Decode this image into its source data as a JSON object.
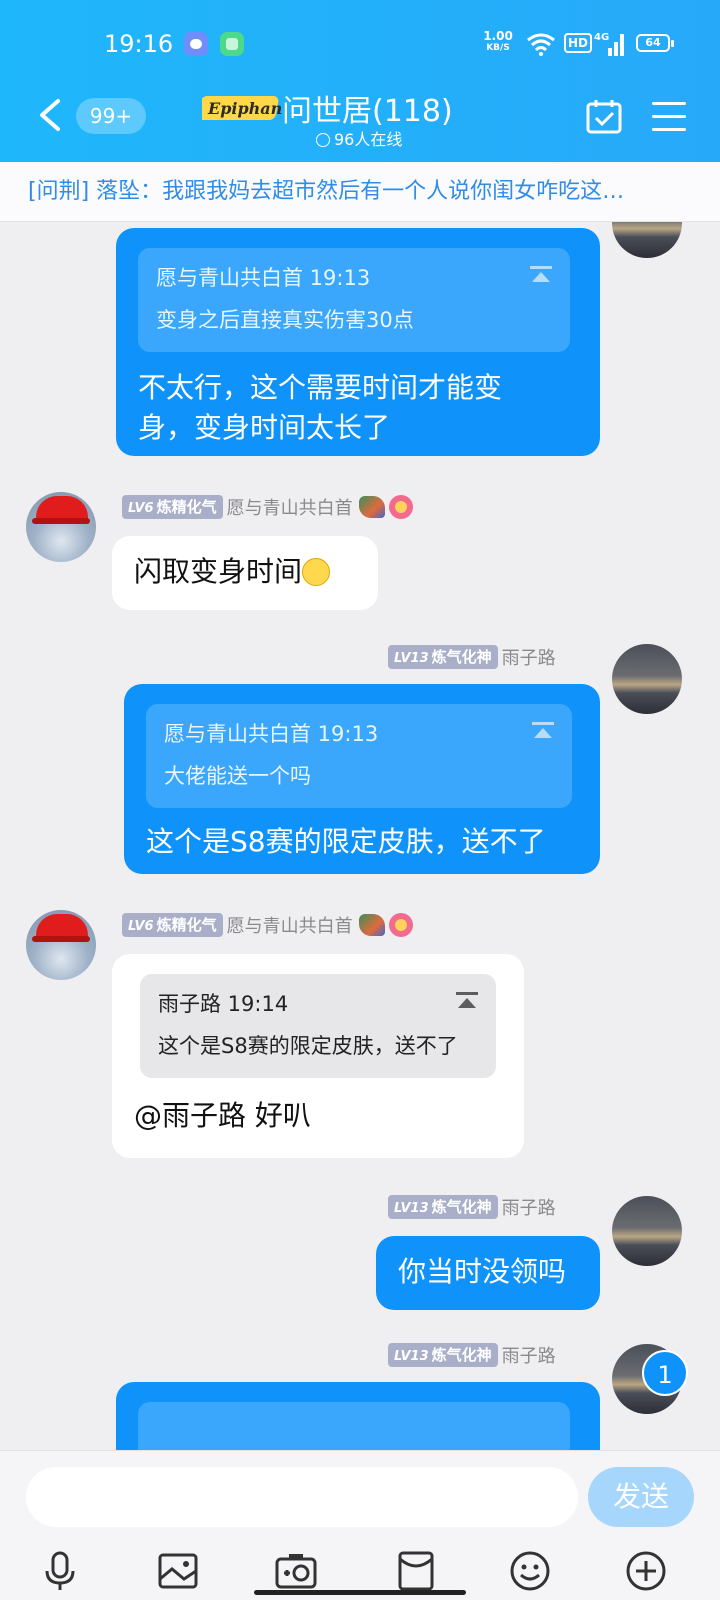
{
  "status_bar": {
    "time": "19:16",
    "net_speed": "1.00",
    "net_unit": "KB/S",
    "hd": "HD",
    "network": "4G",
    "battery": "64"
  },
  "header": {
    "back_count": "99+",
    "logo_text": "Epiphany",
    "title": "问世居(118)",
    "online": "96人在线"
  },
  "notice": {
    "text": "[问荆] 落坠：我跟我妈去超市然后有一个人说你闺女咋吃这…"
  },
  "messages": [
    {
      "quote_head": "愿与青山共白首 19:13",
      "quote_text": "变身之后直接真实伤害30点",
      "line1": "不太行，这个需要时间才能变",
      "line2": "身，变身时间太长了"
    },
    {
      "level": "LV6",
      "title": "炼精化气",
      "sender": "愿与青山共白首",
      "text": "闪取变身时间"
    },
    {
      "level": "LV13",
      "title": "炼气化神",
      "sender": "雨子路",
      "quote_head": "愿与青山共白首 19:13",
      "quote_text": "大佬能送一个吗",
      "text": "这个是S8赛的限定皮肤，送不了"
    },
    {
      "level": "LV6",
      "title": "炼精化气",
      "sender": "愿与青山共白首",
      "quote_head": "雨子路 19:14",
      "quote_text": "这个是S8赛的限定皮肤，送不了",
      "text": "@雨子路 好叭"
    },
    {
      "level": "LV13",
      "title": "炼气化神",
      "sender": "雨子路",
      "text": "你当时没领吗"
    },
    {
      "level": "LV13",
      "title": "炼气化神",
      "sender": "雨子路"
    }
  ],
  "unread_count": "1",
  "input": {
    "placeholder": "",
    "send_label": "发送"
  },
  "toolbar": [
    "mic-icon",
    "image-icon",
    "camera-icon",
    "red-packet-icon",
    "emoji-icon",
    "plus-icon"
  ],
  "colors": {
    "header": "#1fb7fb",
    "my_bubble": "#0f93fb",
    "level_badge": "#a9afc8",
    "notice_text": "#2f8de7"
  }
}
